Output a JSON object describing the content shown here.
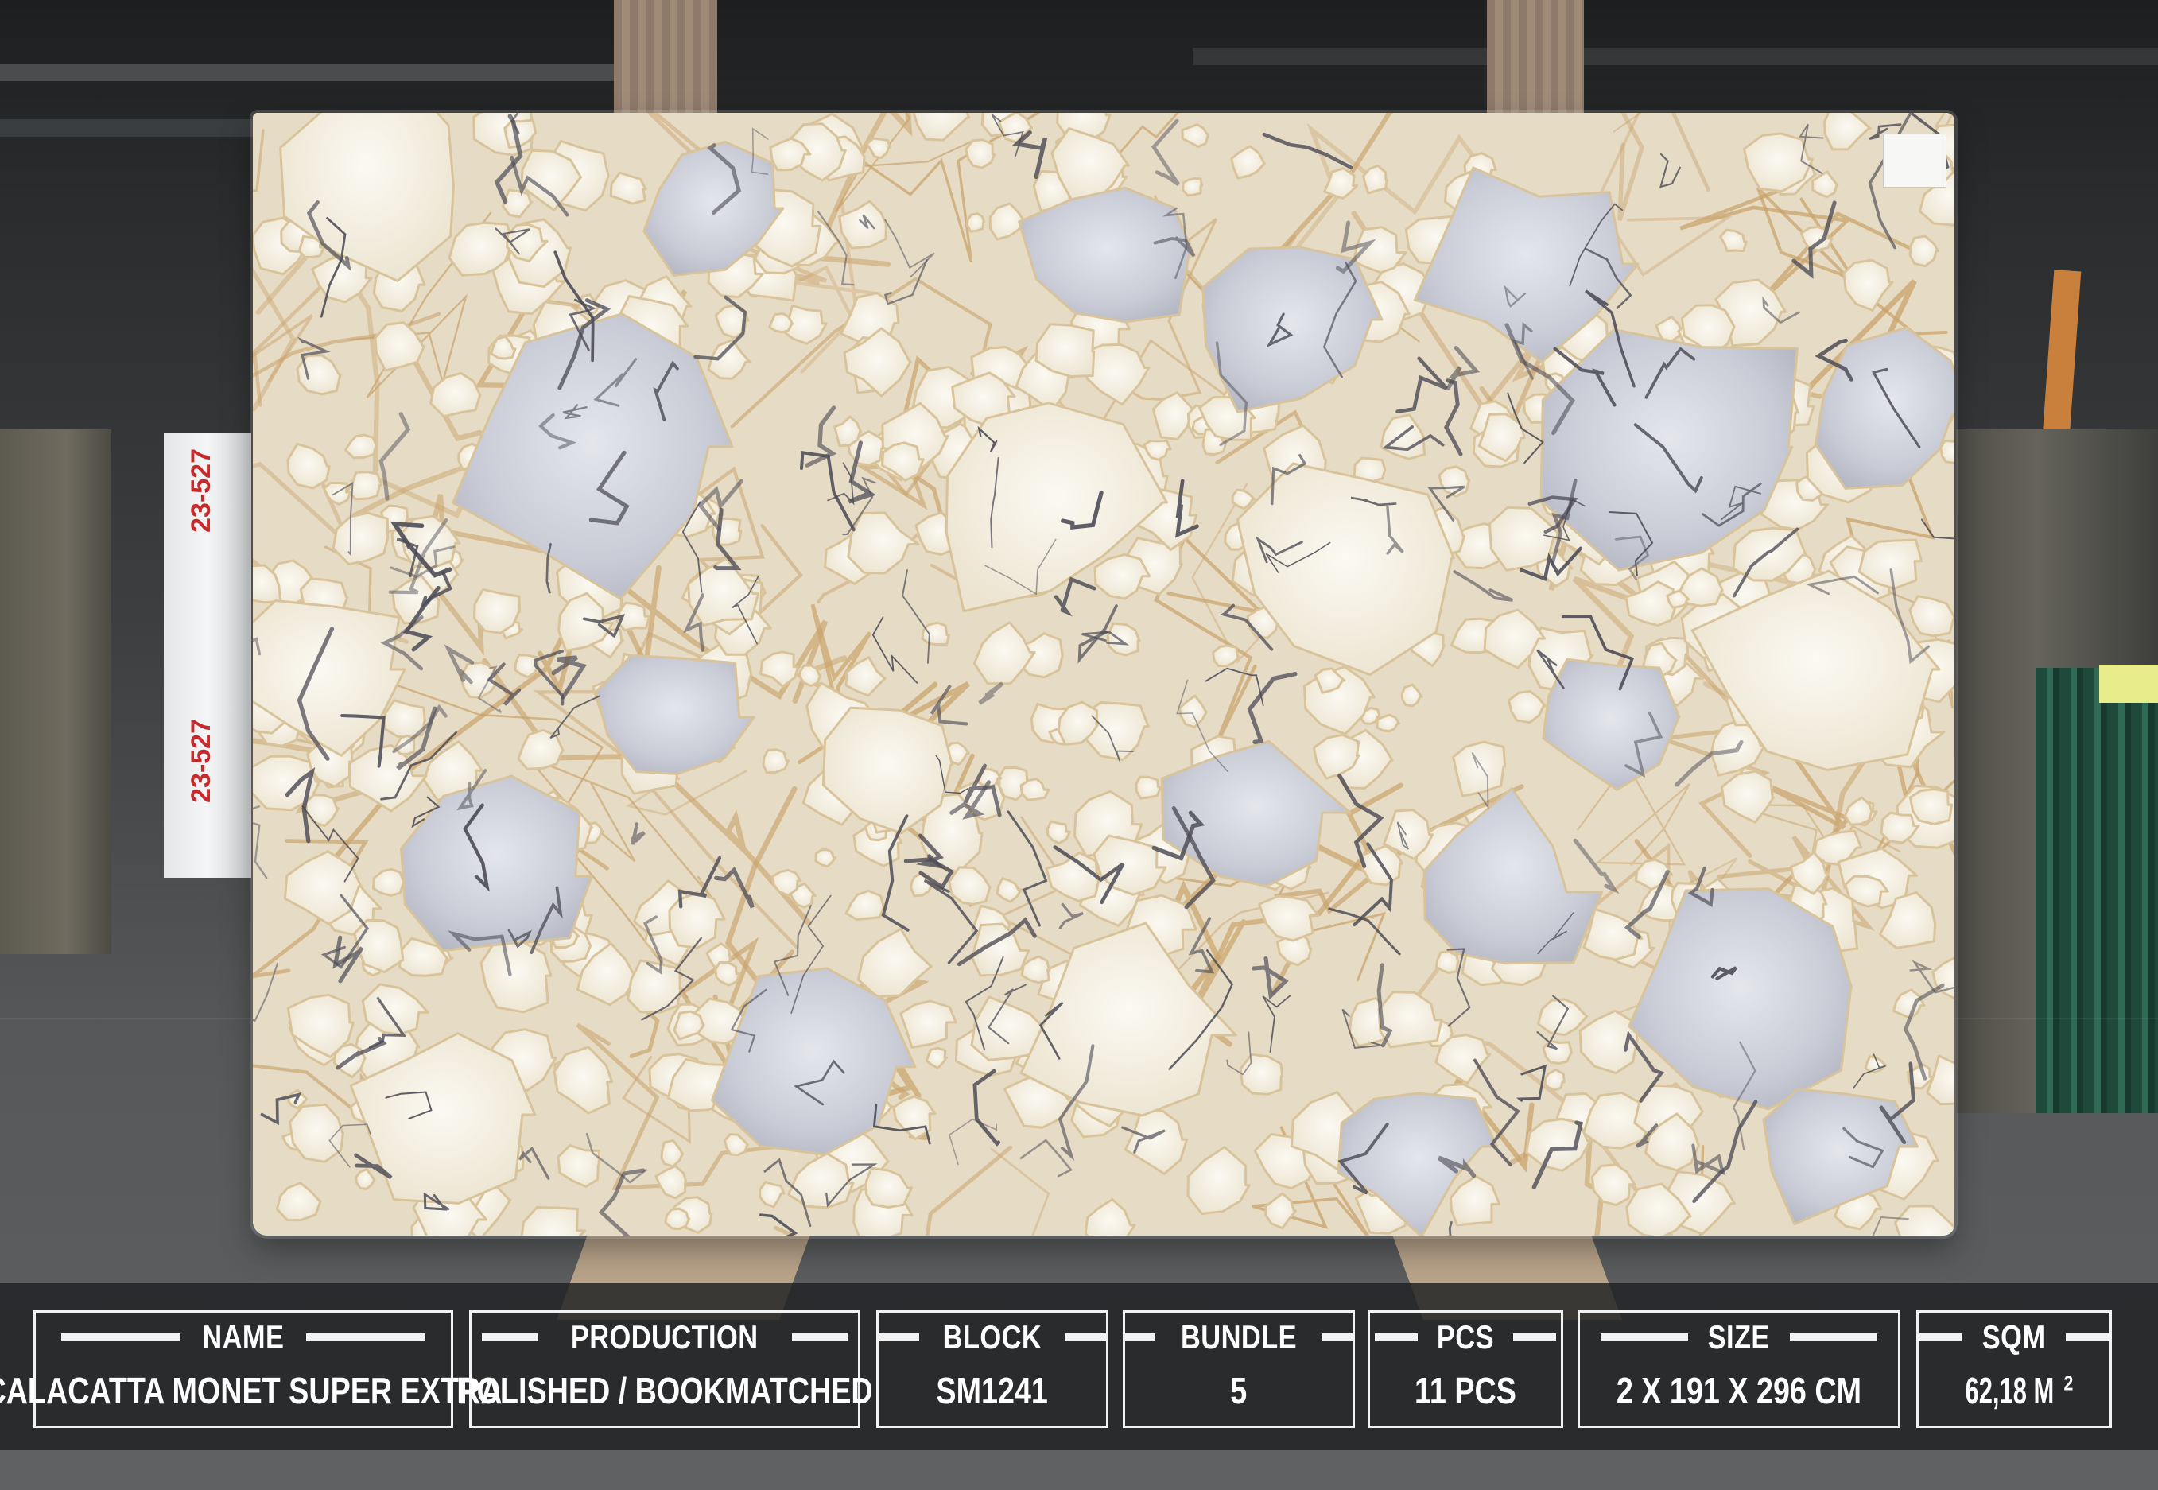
{
  "slab_info": {
    "name": {
      "label": "NAME",
      "value": "CALACATTA MONET SUPER EXTRA"
    },
    "production": {
      "label": "PRODUCTION",
      "value": "POLISHED /  BOOKMATCHED"
    },
    "block": {
      "label": "BLOCK",
      "value": "SM1241"
    },
    "bundle": {
      "label": "BUNDLE",
      "value": "5"
    },
    "pcs": {
      "label": "PCS",
      "value": "11 PCS"
    },
    "size": {
      "label": "SIZE",
      "value": "2 X 191 X  296 CM"
    },
    "sqm": {
      "label": "SQM",
      "value": "62,18 M",
      "value_superscript": "2"
    }
  },
  "background_marks": {
    "panel_text_upper": "23-527",
    "panel_text_lower": "23-527"
  },
  "colors": {
    "bar_background": "#1e2022",
    "box_border": "#f2f2f2",
    "text": "#ffffff",
    "marble_base": "#ebe3d2",
    "vein_dark": "#4b4a55",
    "vein_gold": "#c9a26a",
    "clast_grey": "#c9ccd6"
  }
}
